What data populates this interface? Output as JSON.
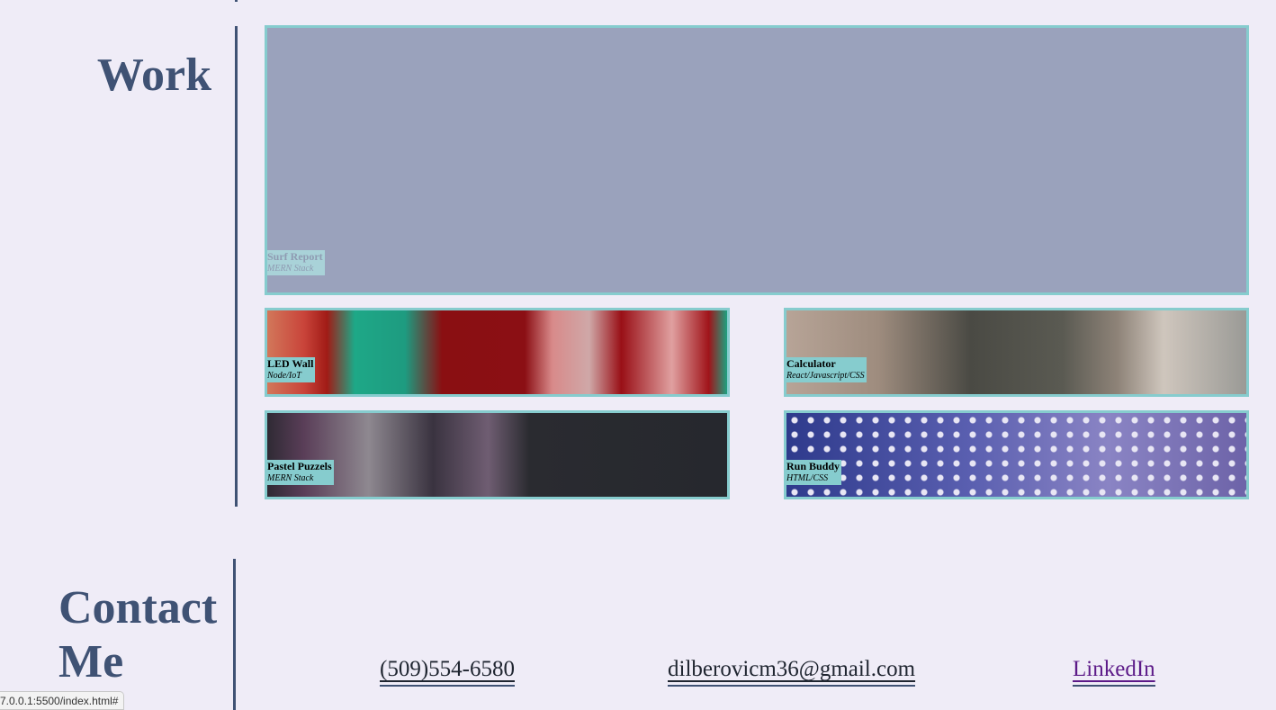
{
  "work": {
    "heading": "Work",
    "projects": [
      {
        "name": "Surf Report",
        "stack": "MERN Stack",
        "thumbnail": "solid-slate-placeholder"
      },
      {
        "name": "LED Wall",
        "stack": "Node/IoT",
        "thumbnail": "red-teal-geometric-wall"
      },
      {
        "name": "Calculator",
        "stack": "React/Javascript/CSS",
        "thumbnail": "blurred-office-interior"
      },
      {
        "name": "Pastel Puzzels",
        "stack": "MERN Stack",
        "thumbnail": "code-editor-screen"
      },
      {
        "name": "Run Buddy",
        "stack": "HTML/CSS",
        "thumbnail": "purple-hexagon-mesh"
      }
    ]
  },
  "contact": {
    "heading_line1": "Contact",
    "heading_line2": "Me",
    "phone": "(509)554-6580",
    "email": "dilberovicm36@gmail.com",
    "linkedin": "LinkedIn"
  },
  "status_bar": {
    "url": "7.0.0.1:5500/index.html#"
  },
  "colors": {
    "accent": "#86ccce",
    "heading": "#3f5274",
    "background": "#efecf7"
  }
}
